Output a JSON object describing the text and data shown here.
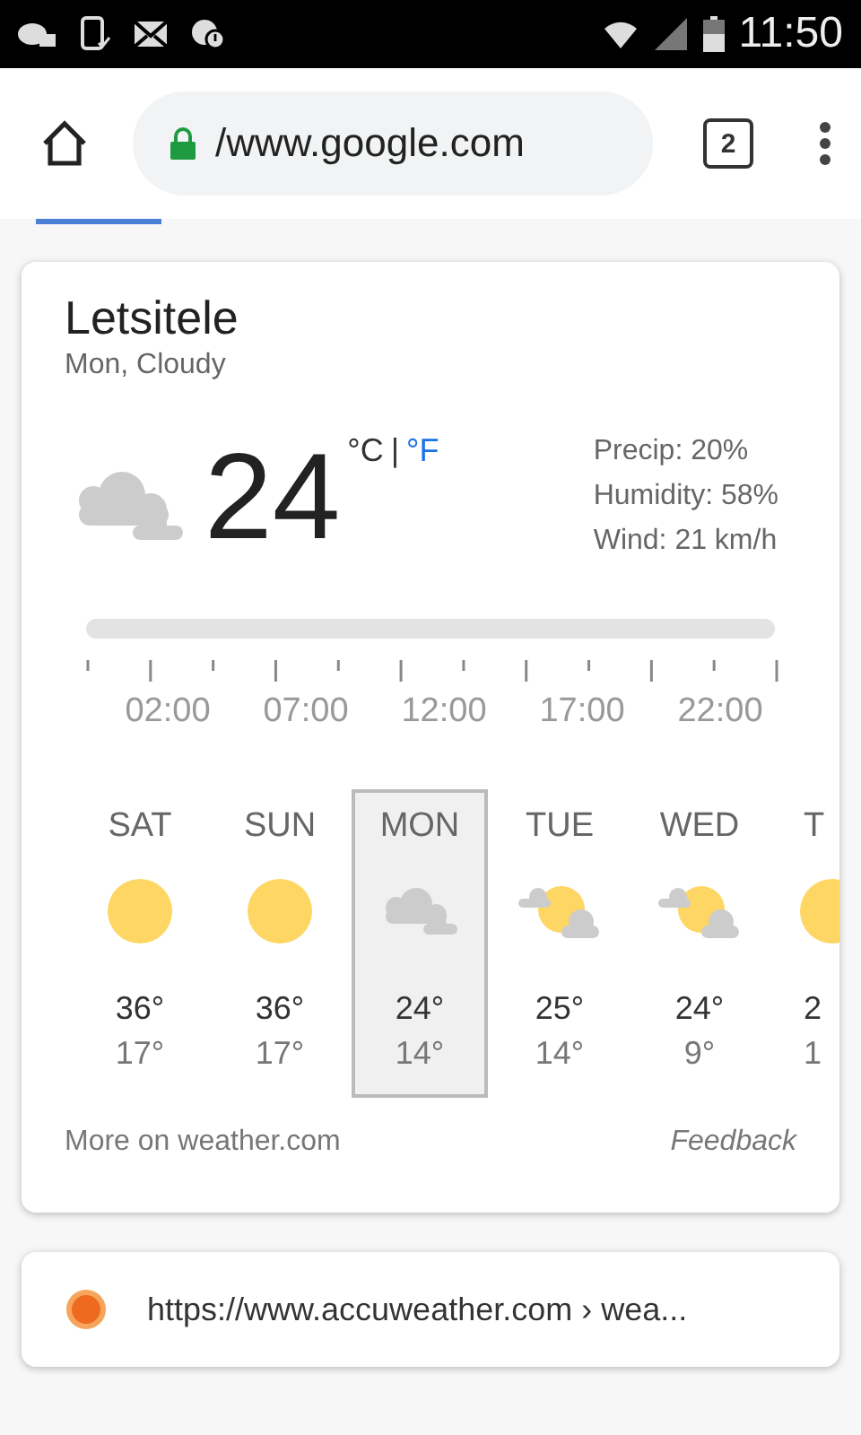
{
  "status_bar": {
    "time": "11:50"
  },
  "browser": {
    "url": "/www.google.com",
    "tab_count": "2"
  },
  "weather": {
    "location": "Letsitele",
    "summary": "Mon, Cloudy",
    "temperature": "24",
    "unit_c": "°C",
    "separator": "|",
    "unit_f": "°F",
    "details": [
      "Precip: 20%",
      "Humidity: 58%",
      "Wind: 21 km/h"
    ],
    "times": [
      "02:00",
      "07:00",
      "12:00",
      "17:00",
      "22:00"
    ],
    "days": [
      {
        "day": "SAT",
        "kind": "sun",
        "high": "36°",
        "low": "17°",
        "selected": false
      },
      {
        "day": "SUN",
        "kind": "sun",
        "high": "36°",
        "low": "17°",
        "selected": false
      },
      {
        "day": "MON",
        "kind": "cloudy",
        "high": "24°",
        "low": "14°",
        "selected": true
      },
      {
        "day": "TUE",
        "kind": "partly",
        "high": "25°",
        "low": "14°",
        "selected": false
      },
      {
        "day": "WED",
        "kind": "partly",
        "high": "24°",
        "low": "9°",
        "selected": false
      },
      {
        "day": "T",
        "kind": "sun",
        "high": "2",
        "low": "1",
        "selected": false
      }
    ],
    "more_link": "More on weather.com",
    "feedback": "Feedback"
  },
  "result": {
    "url": "https://www.accuweather.com › wea..."
  }
}
